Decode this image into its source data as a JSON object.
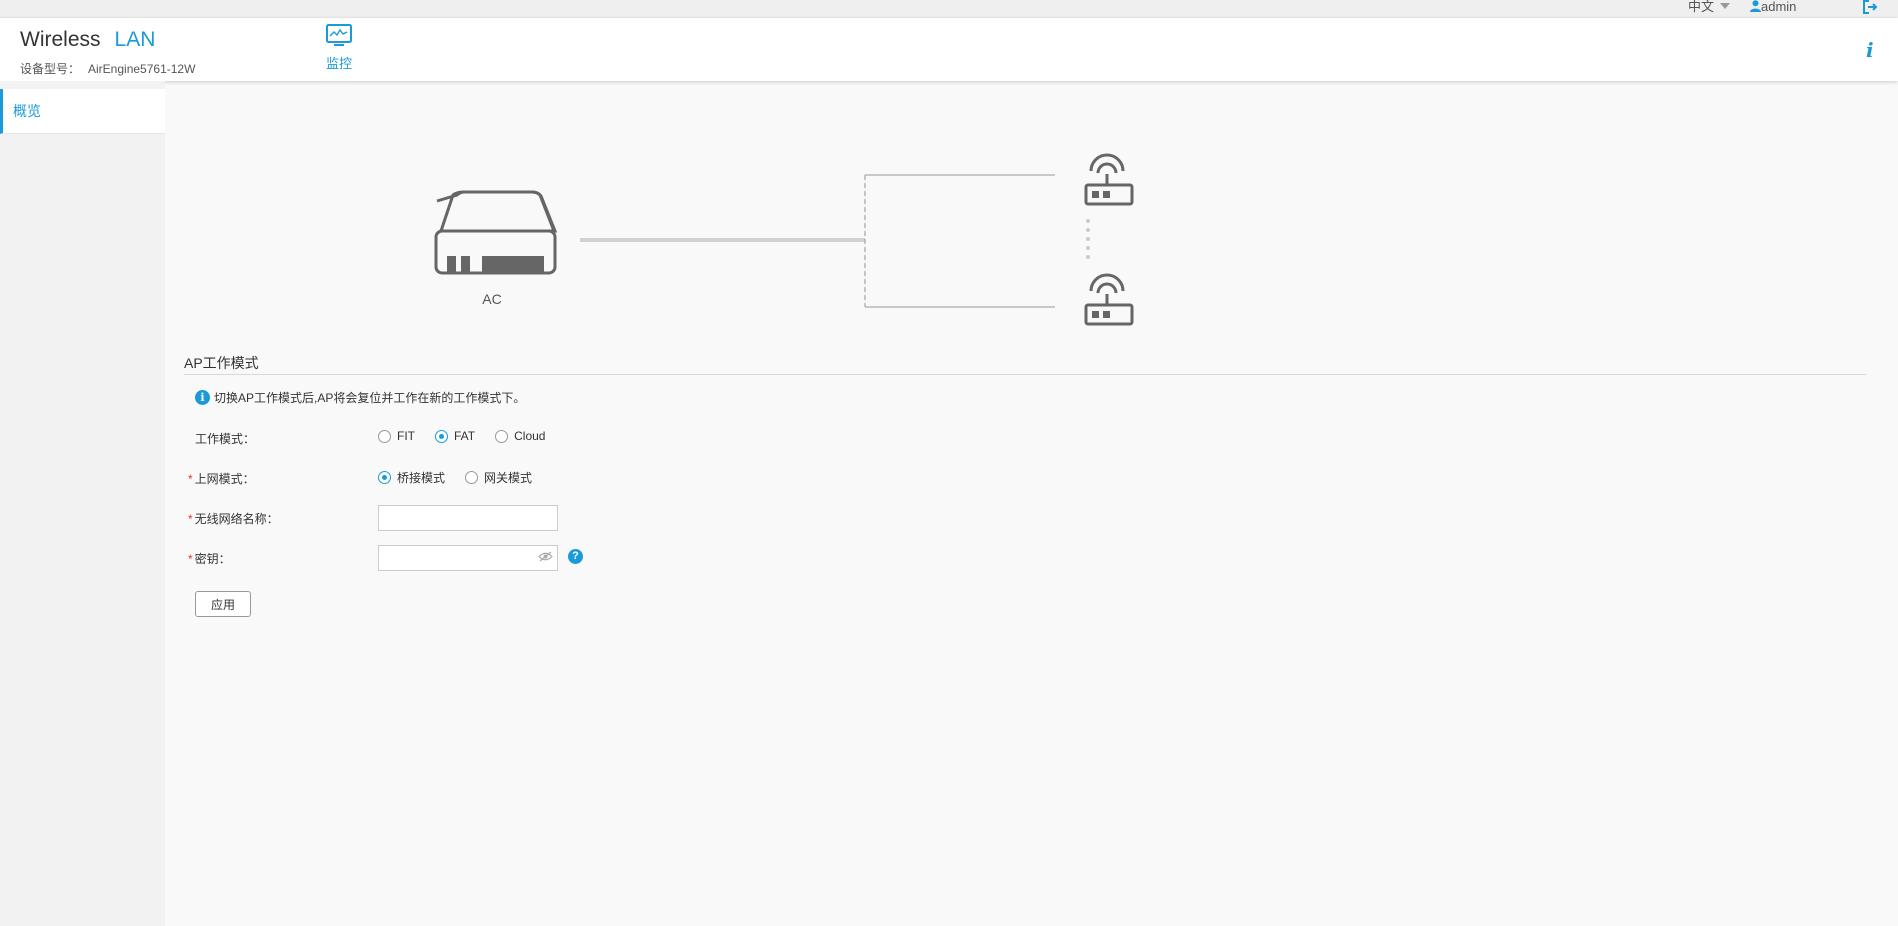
{
  "topbar": {
    "language": "中文",
    "username": "admin"
  },
  "header": {
    "brand_primary": "Wireless",
    "brand_secondary": "LAN",
    "model_label": "设备型号：",
    "model_value": "AirEngine5761-12W",
    "nav_monitor_label": "监控"
  },
  "sidebar": {
    "items": [
      {
        "label": "概览",
        "active": true
      }
    ]
  },
  "diagram": {
    "ac_label": "AC"
  },
  "section": {
    "title": "AP工作模式",
    "notice": "切换AP工作模式后,AP将会复位并工作在新的工作模式下。"
  },
  "form": {
    "work_mode": {
      "label": "工作模式：",
      "options": [
        "FIT",
        "FAT",
        "Cloud"
      ],
      "selected": "FAT"
    },
    "uplink_mode": {
      "label": "上网模式：",
      "required": true,
      "options": [
        "桥接模式",
        "网关模式"
      ],
      "selected": "桥接模式"
    },
    "ssid": {
      "label": "无线网络名称：",
      "required": true,
      "value": ""
    },
    "key": {
      "label": "密钥：",
      "required": true,
      "value": ""
    },
    "apply_label": "应用"
  },
  "colors": {
    "accent": "#1a9bd7",
    "required": "#ee3333"
  }
}
